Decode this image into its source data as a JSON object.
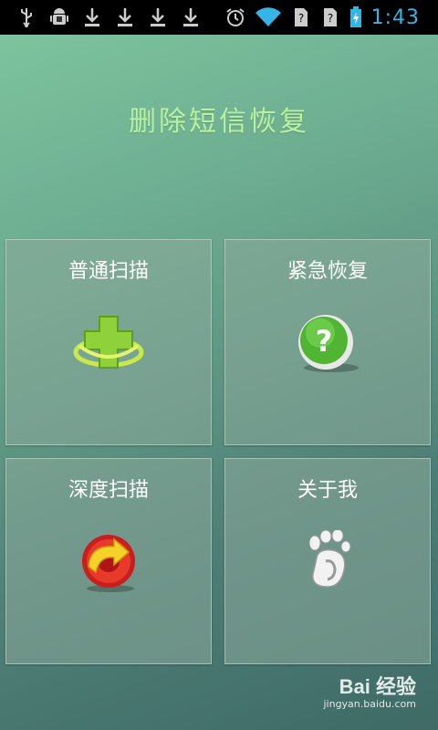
{
  "status_bar": {
    "icons_left": [
      "usb-icon",
      "android-debug-icon",
      "download-icon",
      "download-icon",
      "download-icon",
      "download-icon"
    ],
    "icons_right": [
      "alarm-icon",
      "wifi-icon",
      "sim-unknown-icon",
      "sim-unknown-icon",
      "battery-charging-icon"
    ],
    "time": "1:43"
  },
  "app": {
    "title": "删除短信恢复"
  },
  "menu": {
    "normal_scan": {
      "label": "普通扫描",
      "icon": "green-plus-icon"
    },
    "emergency_restore": {
      "label": "紧急恢复",
      "icon": "green-question-icon"
    },
    "deep_scan": {
      "label": "深度扫描",
      "icon": "red-refresh-icon"
    },
    "about_me": {
      "label": "关于我",
      "icon": "gnome-foot-icon"
    }
  },
  "watermark": {
    "brand": "Bai 经验",
    "url": "jingyan.baidu.com"
  },
  "colors": {
    "title": "#b8f2a0",
    "status_time": "#35b5e5",
    "tile_bg": "#8caa9b"
  }
}
